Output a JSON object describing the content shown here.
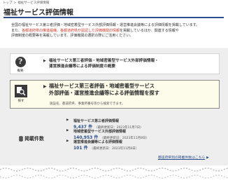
{
  "breadcrumb": {
    "home": "トップ",
    "separator": ">",
    "current": "福祉サービス評価情報"
  },
  "page_title": "福祉サービス評価情報",
  "intro": {
    "line1": "全国の福祉サービス第三者評価・地域密着型サービス外部評価情報・運営推進会議等による評価情報を掲載しています。",
    "line2_pre": "また、",
    "line2_red": "各都道府県の推進組織、各都道府県が認証した評価機関の情報",
    "line2_post": "を掲載しているほか、関連する情報や",
    "line3": "評価制度の概要等を掲載しています。評価機関の選択の際にご活用ください。"
  },
  "cards": {
    "overview": {
      "icon": "question-icon",
      "icon_glyph": "?",
      "caption": "概要",
      "title_line1": "福祉サービス第三者評価・地域密着型サービス外部評価情報・",
      "title_line2": "運営推進会議等による評価制度の概要"
    },
    "search": {
      "icon": "search-icon",
      "caption": "探す",
      "title_line1": "福祉サービス第三者評価・地域密着型サービス",
      "title_line2": "外部評価・運営推進会議等による評価情報を探す",
      "subtitle": "施設名、都道府県、事業所番号等から検索できます。"
    }
  },
  "stats": {
    "label": "掲載件数",
    "items": [
      {
        "name": "福祉サービス第三者評価情報",
        "count": "9,437 件",
        "date": "（最終更新日：2023年11月7日）"
      },
      {
        "name": "地域密着型サービス外部評価情報",
        "count": "140,953 件",
        "date": "（最終更新日：2023年11月8日）"
      },
      {
        "name": "運営推進会議等による評価情報",
        "count": "101 件",
        "date": "（最終更新日：2023年11月8日）"
      }
    ],
    "link_label": "都道府県別の掲載件数はこちら",
    "link_chevron": "▶"
  },
  "colors": {
    "accent": "#2b4f8c",
    "highlight_red": "#d43a2a",
    "search_card_bg": "#fdfbea",
    "section_bg": "#eeeeee"
  }
}
